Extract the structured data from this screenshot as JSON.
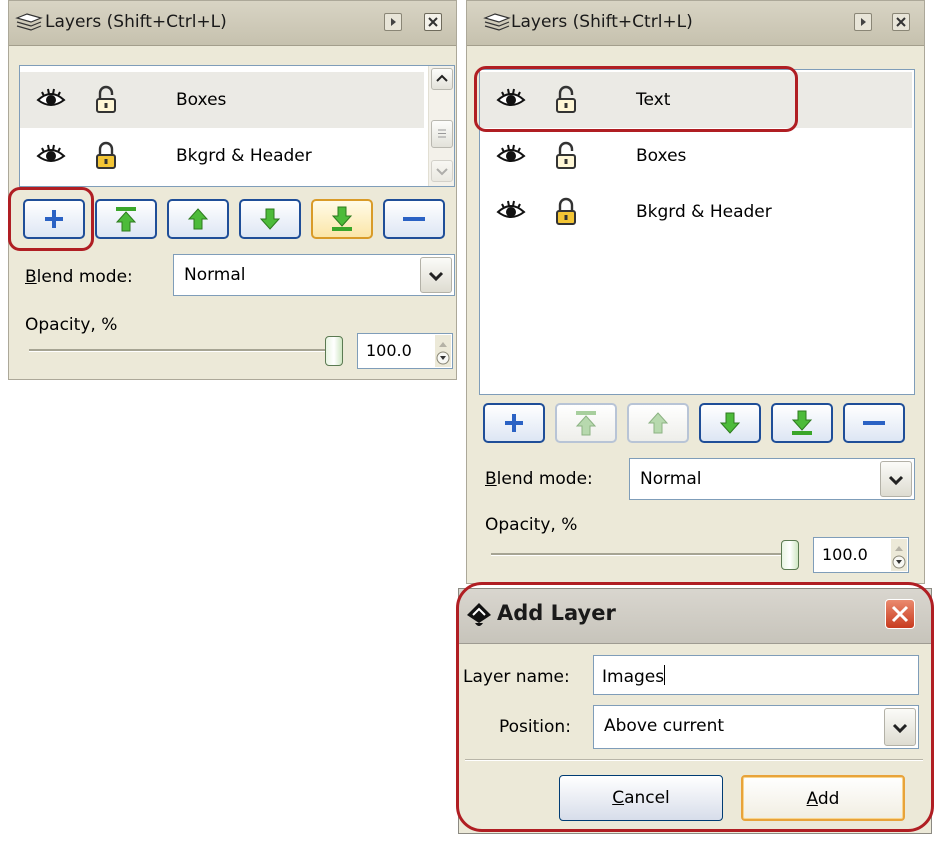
{
  "left_panel": {
    "title": "Layers (Shift+Ctrl+L)",
    "layers": [
      {
        "name": "Boxes",
        "locked": false,
        "selected": true
      },
      {
        "name": "Bkgrd & Header",
        "locked": true,
        "selected": false
      }
    ],
    "blend_label_accel": "B",
    "blend_label_rest": "lend mode:",
    "blend_value": "Normal",
    "opacity_label": "Opacity, %",
    "opacity_value": "100.0",
    "opacity_level": 1.0
  },
  "right_panel": {
    "title": "Layers (Shift+Ctrl+L)",
    "layers": [
      {
        "name": "Text",
        "locked": false,
        "selected": true
      },
      {
        "name": "Boxes",
        "locked": false,
        "selected": false
      },
      {
        "name": "Bkgrd & Header",
        "locked": true,
        "selected": false
      }
    ],
    "blend_label_accel": "B",
    "blend_label_rest": "lend mode:",
    "blend_value": "Normal",
    "opacity_label": "Opacity, %",
    "opacity_value": "100.0",
    "opacity_level": 1.0
  },
  "dialog": {
    "title": "Add Layer",
    "layer_name_label": "Layer name:",
    "layer_name_value": "Images",
    "position_label": "Position:",
    "position_value": "Above current",
    "cancel_accel": "C",
    "cancel_rest": "ancel",
    "add_accel": "A",
    "add_rest": "dd"
  },
  "toolbar_icons": [
    "add-layer-icon",
    "raise-to-top-icon",
    "raise-layer-icon",
    "lower-layer-icon",
    "lower-to-bottom-icon",
    "remove-layer-icon"
  ],
  "colors": {
    "highlight": "#b01e23",
    "button_border": "#1f4e98",
    "arrow_green": "#3aa62a",
    "plus_blue": "#2b62c4",
    "panel_bg": "#ece9d8"
  }
}
